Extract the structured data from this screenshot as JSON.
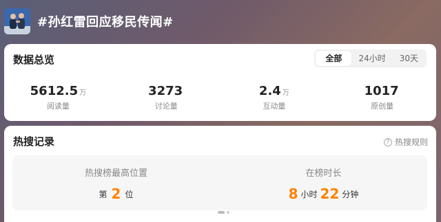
{
  "topic": {
    "title": "#孙红雷回应移民传闻#"
  },
  "overview": {
    "title": "数据总览",
    "tabs": [
      {
        "label": "全部",
        "active": true
      },
      {
        "label": "24小时",
        "active": false
      },
      {
        "label": "30天",
        "active": false
      }
    ],
    "stats": [
      {
        "value": "5612.5",
        "unit": "万",
        "label": "阅读量"
      },
      {
        "value": "3273",
        "unit": "",
        "label": "讨论量"
      },
      {
        "value": "2.4",
        "unit": "万",
        "label": "互动量"
      },
      {
        "value": "1017",
        "unit": "",
        "label": "原创量"
      }
    ]
  },
  "hot": {
    "title": "热搜记录",
    "rules_label": "热搜规则",
    "peak": {
      "label": "热搜榜最高位置",
      "prefix": "第",
      "value": "2",
      "suffix": "位"
    },
    "duration": {
      "label": "在榜时长",
      "hours": "8",
      "hours_unit": "小时",
      "minutes": "22",
      "minutes_unit": "分钟"
    }
  },
  "colors": {
    "accent": "#ff8200",
    "card": "#ffffff"
  }
}
